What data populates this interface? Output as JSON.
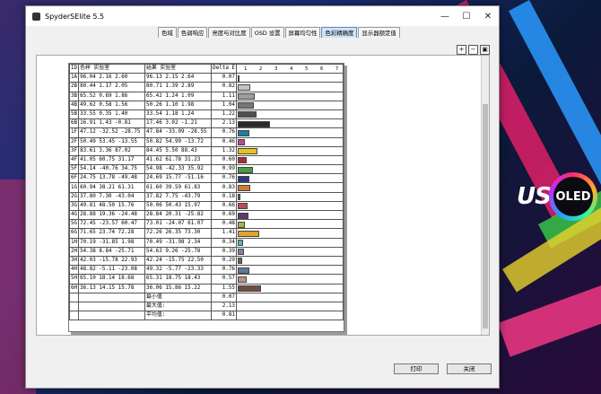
{
  "window": {
    "title": "SpyderSElite 5.5"
  },
  "tabs": [
    "色域",
    "色调响应",
    "亮度与对比度",
    "OSD 设置",
    "屏幕均匀性",
    "色彩精确度",
    "显示器额定值"
  ],
  "active_tab": 5,
  "header": {
    "id": "ID",
    "target": "色样 实验室",
    "measured": "结果 实验室",
    "delta": "Delta E",
    "scale": [
      "1",
      "2",
      "3",
      "4",
      "5",
      "6",
      "7"
    ]
  },
  "rows": [
    {
      "id": "1A",
      "t": "96.04  2.16  2.60",
      "m": "96.13  2.15  2.64",
      "d": "0.07",
      "de": 0.07,
      "color": "#f2efe9"
    },
    {
      "id": "2B",
      "t": "80.44  1.17  2.05",
      "m": "80.71  1.39  2.89",
      "d": "0.82",
      "de": 0.82,
      "color": "#c6c4c1"
    },
    {
      "id": "3B",
      "t": "65.52  0.69  1.86",
      "m": "65.42  1.24  1.09",
      "d": "1.11",
      "de": 1.11,
      "color": "#9f9d9b"
    },
    {
      "id": "4B",
      "t": "49.62  0.58  1.56",
      "m": "50.26  1.10  1.98",
      "d": "1.04",
      "de": 1.04,
      "color": "#777675"
    },
    {
      "id": "5B",
      "t": "33.55  0.35  1.40",
      "m": "33.54  1.18  1.24",
      "d": "1.22",
      "de": 1.22,
      "color": "#504f4e"
    },
    {
      "id": "6B",
      "t": "16.91  1.43 -0.81",
      "m": "17.46  3.02 -1.21",
      "d": "2.13",
      "de": 2.13,
      "color": "#2a2829"
    },
    {
      "id": "1F",
      "t": "47.12 -32.52 -28.75",
      "m": "47.84 -33.09 -28.55",
      "d": "0.76",
      "de": 0.76,
      "color": "#1f7f9a"
    },
    {
      "id": "2F",
      "t": "50.49  53.45 -13.55",
      "m": "50.82  54.99 -13.72",
      "d": "0.46",
      "de": 0.46,
      "color": "#b2508a"
    },
    {
      "id": "3F",
      "t": "83.61  3.36  87.02",
      "m": "84.45  5.50  88.43",
      "d": "1.32",
      "de": 1.32,
      "color": "#e6c21a"
    },
    {
      "id": "4F",
      "t": "41.05  60.75  31.17",
      "m": "41.62  61.78  31.23",
      "d": "0.60",
      "de": 0.6,
      "color": "#b02a33"
    },
    {
      "id": "5F",
      "t": "54.14 -40.76  34.75",
      "m": "54.98 -42.33  35.92",
      "d": "0.99",
      "de": 0.99,
      "color": "#4e9a45"
    },
    {
      "id": "6F",
      "t": "24.75  13.78 -49.48",
      "m": "24.69  15.77 -51.16",
      "d": "0.76",
      "de": 0.76,
      "color": "#2c3a8a"
    },
    {
      "id": "1G",
      "t": "60.94  38.21  61.31",
      "m": "61.60  39.59  61.83",
      "d": "0.83",
      "de": 0.83,
      "color": "#d27a2e"
    },
    {
      "id": "2G",
      "t": "37.80  7.30 -43.04",
      "m": "37.82  7.75 -43.79",
      "d": "0.18",
      "de": 0.18,
      "color": "#4b5b9c"
    },
    {
      "id": "3G",
      "t": "49.81  48.50  15.76",
      "m": "50.06  50.43  15.97",
      "d": "0.66",
      "de": 0.66,
      "color": "#be4a5e"
    },
    {
      "id": "4G",
      "t": "28.88  19.36 -24.48",
      "m": "28.84  20.31 -25.82",
      "d": "0.69",
      "de": 0.69,
      "color": "#5b3c6a"
    },
    {
      "id": "5G",
      "t": "72.45 -23.57  60.47",
      "m": "73.01 -24.07  61.07",
      "d": "0.48",
      "de": 0.48,
      "color": "#9bbb3f"
    },
    {
      "id": "6G",
      "t": "71.65  23.74  72.28",
      "m": "72.26  26.35  73.30",
      "d": "1.41",
      "de": 1.41,
      "color": "#e3a22b"
    },
    {
      "id": "1H",
      "t": "70.19 -31.85  1.98",
      "m": "70.49 -31.98  2.34",
      "d": "0.34",
      "de": 0.34,
      "color": "#5cb5a5"
    },
    {
      "id": "2H",
      "t": "54.38  8.84 -25.71",
      "m": "54.63  9.26 -25.78",
      "d": "0.39",
      "de": 0.39,
      "color": "#7f7fae"
    },
    {
      "id": "3H",
      "t": "42.03 -15.78  22.93",
      "m": "42.24 -15.75  22.50",
      "d": "0.29",
      "de": 0.29,
      "color": "#5c6f46"
    },
    {
      "id": "4H",
      "t": "48.82 -5.11 -23.08",
      "m": "49.32 -5.77 -23.33",
      "d": "0.76",
      "de": 0.76,
      "color": "#5e7a99"
    },
    {
      "id": "5H",
      "t": "65.10  18.14  18.68",
      "m": "65.31  18.75  18.43",
      "d": "0.57",
      "de": 0.57,
      "color": "#c08f82"
    },
    {
      "id": "6H",
      "t": "36.13  14.15  15.78",
      "m": "36.06  15.86  15.22",
      "d": "1.55",
      "de": 1.55,
      "color": "#6e4d40"
    }
  ],
  "summary": [
    {
      "label": "最小值",
      "value": "0.07"
    },
    {
      "label": "最大值:",
      "value": "2.13"
    },
    {
      "label": "平均值:",
      "value": "0.81"
    }
  ],
  "buttons": {
    "print": "打印",
    "close": "关闭"
  },
  "overlay": {
    "brand": "US",
    "oled": "OLED"
  }
}
